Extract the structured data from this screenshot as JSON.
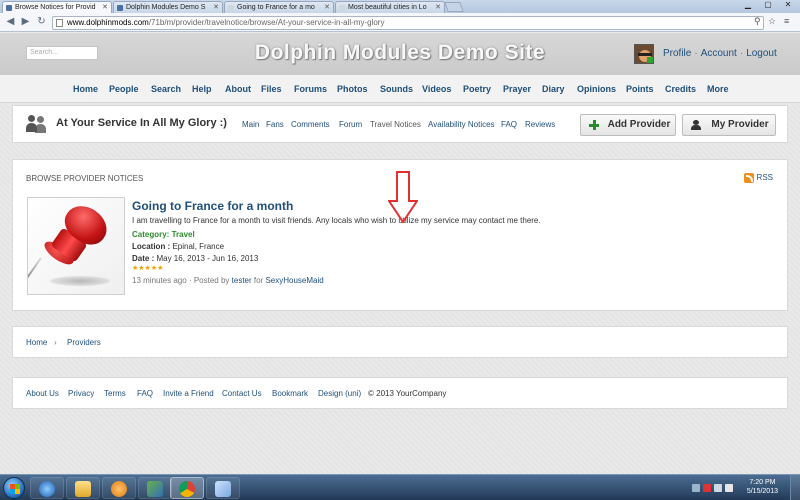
{
  "browser": {
    "tabs": [
      {
        "label": "Browse Notices for Provid"
      },
      {
        "label": "Dolphin Modules Demo S"
      },
      {
        "label": "Going to France for a mo"
      },
      {
        "label": "Most beautiful cities in Lo"
      }
    ],
    "url_host": "www.dolphinmods.com",
    "url_path": "/71b/m/provider/travelnotice/browse/At-your-service-in-all-my-glory"
  },
  "site": {
    "search_placeholder": "Search...",
    "title": "Dolphin Modules Demo Site",
    "user_links": [
      "Profile",
      "Account",
      "Logout"
    ],
    "nav": [
      "Home",
      "People",
      "Search",
      "Help",
      "About",
      "Files",
      "Forums",
      "Photos",
      "Sounds",
      "Videos",
      "Poetry",
      "Prayer",
      "Diary",
      "Opinions",
      "Points",
      "Credits",
      "More"
    ]
  },
  "provider": {
    "title": "At Your Service In All My Glory :)",
    "subnav": [
      "Main",
      "Fans",
      "Comments",
      "Forum",
      "Travel Notices",
      "Availability Notices",
      "FAQ",
      "Reviews"
    ],
    "add_button": "Add Provider",
    "my_button": "My Provider"
  },
  "notices": {
    "heading": "BROWSE PROVIDER NOTICES",
    "rss": "RSS",
    "item": {
      "title": "Going to France for a month",
      "description": "I am travelling to France for a month to visit friends. Any locals who wish to utilize my service may contact me there.",
      "category_label": "Category:",
      "category": "Travel",
      "location_label": "Location :",
      "location": "Epinal, France",
      "date_label": "Date :",
      "date": "May 16, 2013 - Jun 16, 2013",
      "stars": "★★★★★",
      "rating": 5,
      "time_ago": "13 minutes ago",
      "posted_by_label": "· Posted by",
      "author": "tester",
      "for_label": "for",
      "recipient": "SexyHouseMaid"
    }
  },
  "breadcrumb": {
    "items": [
      "Home",
      "Providers"
    ],
    "separator": "›"
  },
  "footer": {
    "links": [
      "About Us",
      "Privacy",
      "Terms",
      "FAQ",
      "Invite a Friend",
      "Contact Us",
      "Bookmark",
      "Design (uni)"
    ],
    "copyright": "© 2013 YourCompany"
  },
  "taskbar": {
    "time": "7:20 PM",
    "date": "5/15/2013"
  },
  "colors": {
    "link": "#1f4f7a",
    "category": "#2e8b2e",
    "arrow": "#e03030",
    "stars": "#f0a000"
  }
}
